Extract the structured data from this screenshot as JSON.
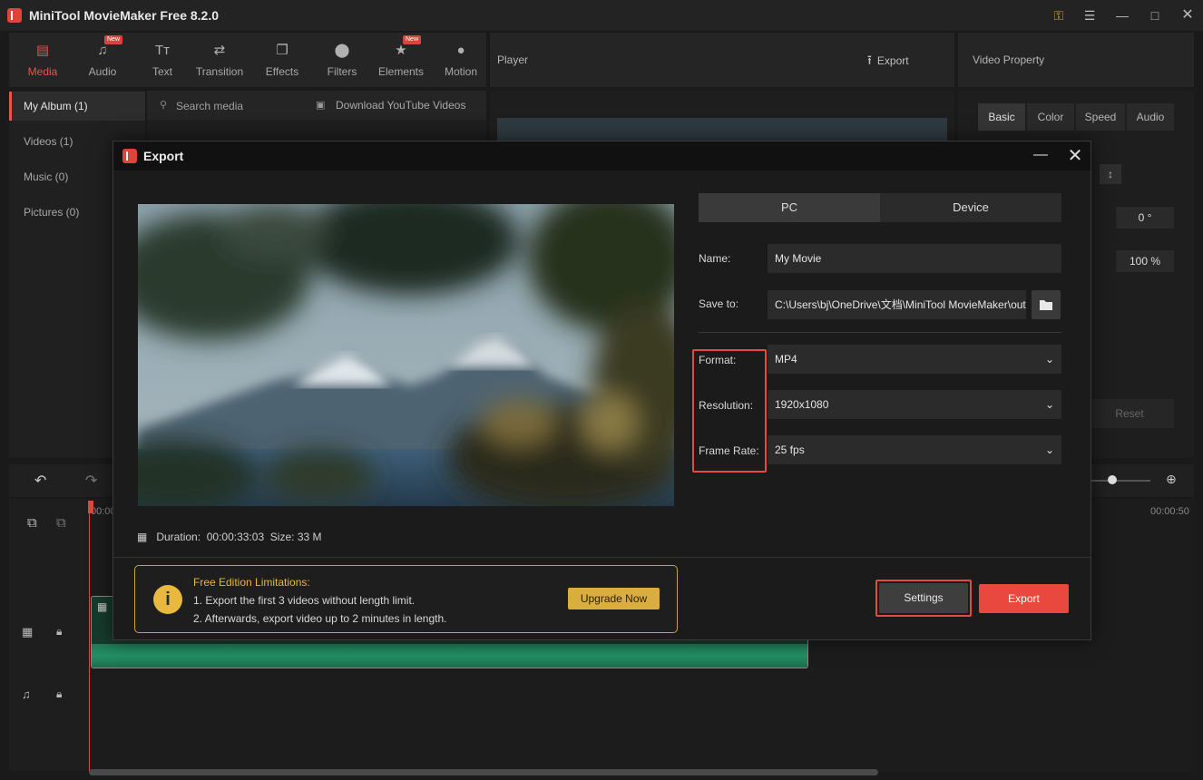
{
  "app": {
    "title": "MiniTool MovieMaker Free 8.2.0"
  },
  "toolbar": {
    "tools": [
      {
        "label": "Media",
        "icon": "media-icon",
        "active": true
      },
      {
        "label": "Audio",
        "icon": "music-note-icon",
        "badge": "New"
      },
      {
        "label": "Text",
        "icon": "text-icon"
      },
      {
        "label": "Transition",
        "icon": "transition-arrows-icon"
      },
      {
        "label": "Effects",
        "icon": "effects-icon"
      },
      {
        "label": "Filters",
        "icon": "filters-icon"
      },
      {
        "label": "Elements",
        "icon": "elements-icon",
        "badge": "New"
      },
      {
        "label": "Motion",
        "icon": "motion-icon"
      }
    ]
  },
  "player": {
    "label": "Player",
    "export_label": "Export"
  },
  "property": {
    "label": "Video Property",
    "tabs": [
      "Basic",
      "Color",
      "Speed",
      "Audio"
    ],
    "rotation_value": "0 °",
    "scale_value": "100 %",
    "reset_label": "Reset"
  },
  "media": {
    "albums": [
      {
        "label": "My Album (1)",
        "active": true
      },
      {
        "label": "Videos (1)"
      },
      {
        "label": "Music (0)"
      },
      {
        "label": "Pictures (0)"
      }
    ],
    "search_placeholder": "Search media",
    "download_label": "Download YouTube Videos"
  },
  "timeline": {
    "time_start": "00:00",
    "time_end": "00:00:50"
  },
  "dialog": {
    "title": "Export",
    "tabs": {
      "pc": "PC",
      "device": "Device"
    },
    "fields": {
      "name_label": "Name:",
      "name_value": "My Movie",
      "save_label": "Save to:",
      "save_value": "C:\\Users\\bj\\OneDrive\\文档\\MiniTool MovieMaker\\output",
      "format_label": "Format:",
      "format_value": "MP4",
      "resolution_label": "Resolution:",
      "resolution_value": "1920x1080",
      "framerate_label": "Frame Rate:",
      "framerate_value": "25 fps"
    },
    "info": {
      "duration_label": "Duration:",
      "duration_value": "00:00:33:03",
      "size_label": "Size:",
      "size_value": "33 M"
    },
    "limits": {
      "title": "Free Edition Limitations:",
      "line1": "1. Export the first 3 videos without length limit.",
      "line2": "2. Afterwards, export video up to 2 minutes in length.",
      "upgrade_label": "Upgrade Now"
    },
    "settings_label": "Settings",
    "export_label": "Export"
  },
  "colors": {
    "accent": "#e8483e",
    "warning": "#d9ad3e",
    "highlight": "#e14b41"
  }
}
